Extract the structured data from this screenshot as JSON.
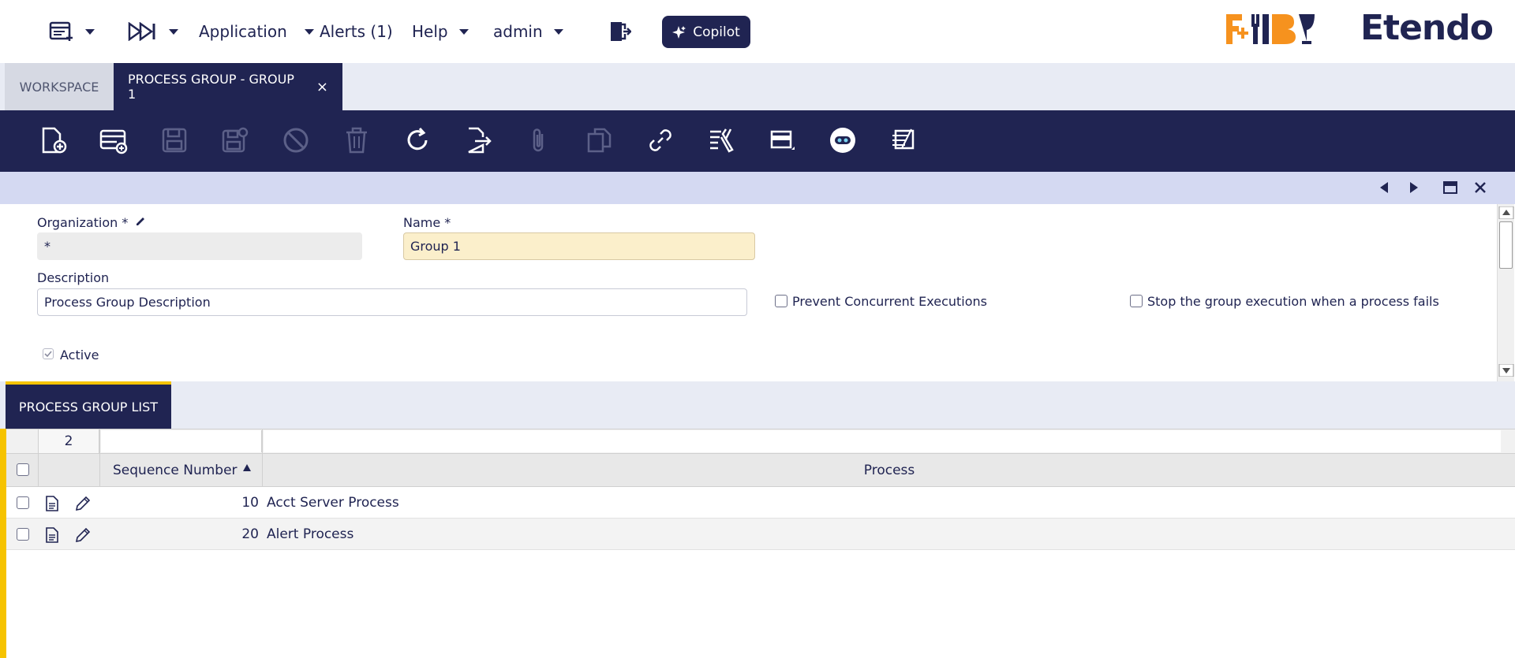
{
  "nav": {
    "application_label": "Application",
    "alerts_label": "Alerts (1)",
    "help_label": "Help",
    "user_label": "admin",
    "copilot_label": "Copilot",
    "brand_logo_text": "F+B",
    "brand_name": "Etendo"
  },
  "tabs": {
    "workspace_label": "WORKSPACE",
    "active_label": "PROCESS GROUP - GROUP 1",
    "close_glyph": "×"
  },
  "toolbar": {
    "icons": [
      "new-document-icon",
      "new-row-icon",
      "save-icon",
      "save-close-icon",
      "cancel-icon",
      "delete-icon",
      "refresh-icon",
      "export-icon",
      "attachment-icon",
      "copy-icon",
      "link-icon",
      "tools-icon",
      "grid-view-icon",
      "copilot-bot-icon",
      "notes-icon"
    ]
  },
  "form": {
    "organization_label": "Organization *",
    "organization_value": "*",
    "name_label": "Name *",
    "name_value": "Group 1",
    "description_label": "Description",
    "description_value": "Process Group Description",
    "prevent_concurrent_label": "Prevent Concurrent Executions",
    "stop_on_fail_label": "Stop the group execution when a process fails",
    "active_label": "Active"
  },
  "subtab": {
    "label": "PROCESS GROUP LIST"
  },
  "grid": {
    "row_count": "2",
    "columns": {
      "sequence": "Sequence Number",
      "process": "Process"
    },
    "rows": [
      {
        "sequence": "10",
        "process": "Acct Server Process"
      },
      {
        "sequence": "20",
        "process": "Alert Process"
      }
    ]
  }
}
